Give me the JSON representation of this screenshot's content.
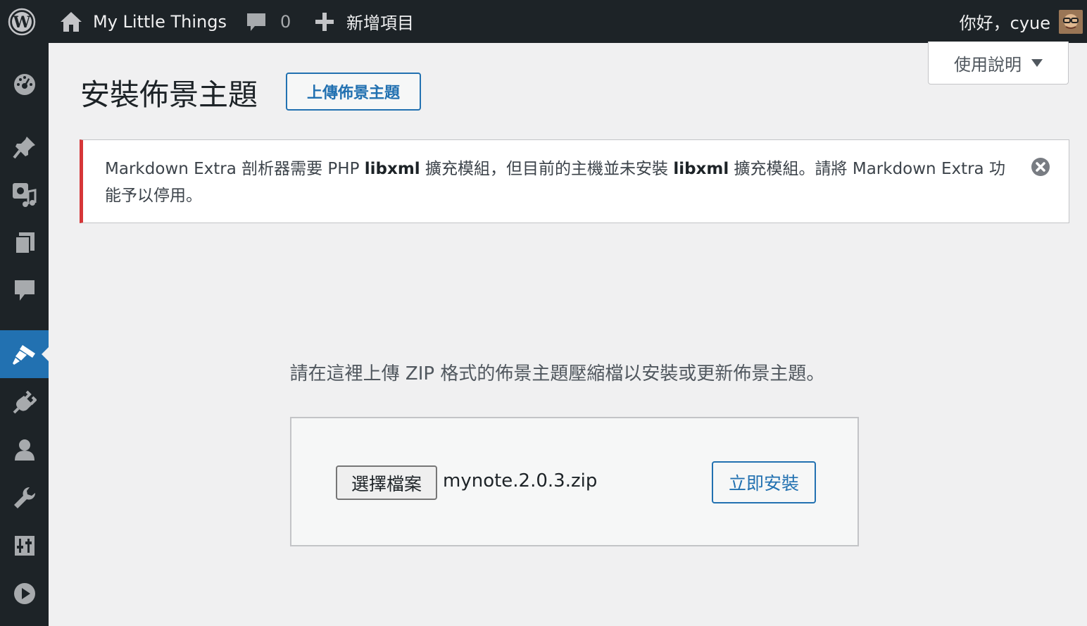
{
  "adminbar": {
    "wp_logo_icon": "wordpress-logo-icon",
    "site_name": "My Little Things",
    "site_icon": "home-icon",
    "comments_icon": "comment-bubble-icon",
    "comments_count": "0",
    "new_icon": "plus-icon",
    "new_label": "新增項目",
    "greeting": "你好，cyue",
    "avatar_icon": "user-avatar"
  },
  "sidebar": {
    "items": [
      {
        "name": "dashboard",
        "icon": "dashboard-gauge-icon"
      },
      {
        "name": "posts",
        "icon": "pushpin-icon"
      },
      {
        "name": "media",
        "icon": "media-icon"
      },
      {
        "name": "pages",
        "icon": "pages-icon"
      },
      {
        "name": "comments",
        "icon": "comment-icon"
      },
      {
        "name": "appearance",
        "icon": "paintbrush-icon",
        "current": true
      },
      {
        "name": "plugins",
        "icon": "plugin-icon"
      },
      {
        "name": "users",
        "icon": "user-icon"
      },
      {
        "name": "tools",
        "icon": "wrench-icon"
      },
      {
        "name": "settings",
        "icon": "sliders-icon"
      },
      {
        "name": "media-player",
        "icon": "play-icon"
      }
    ]
  },
  "help_tab": {
    "label": "使用說明"
  },
  "page": {
    "title": "安裝佈景主題",
    "upload_toggle": "上傳佈景主題"
  },
  "notice": {
    "part1": "Markdown Extra 剖析器需要 PHP ",
    "lib1": "libxml",
    "part2": " 擴充模組，但目前的主機並未安裝 ",
    "lib2": "libxml",
    "part3": " 擴充模組。請將 Markdown Extra 功能予以停用。",
    "color": "#d63638"
  },
  "upload": {
    "help_text": "請在這裡上傳 ZIP 格式的佈景主題壓縮檔以安裝或更新佈景主題。",
    "choose_file": "選擇檔案",
    "file_name": "mynote.2.0.3.zip",
    "install_now": "立即安裝"
  },
  "colors": {
    "adminbar": "#1d2327",
    "accent": "#2271b1",
    "background": "#f0f0f1"
  }
}
